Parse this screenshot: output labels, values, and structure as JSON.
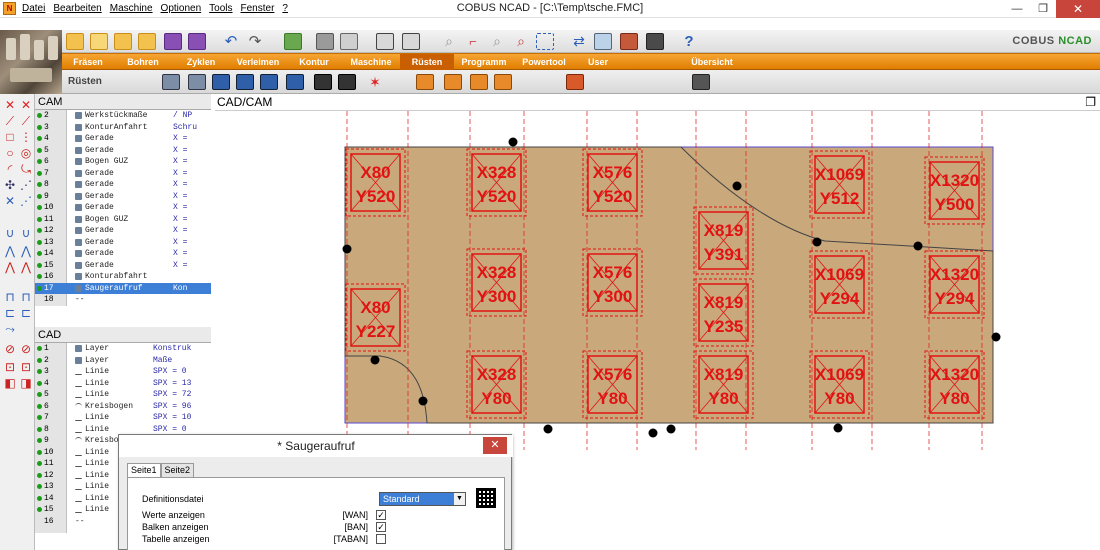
{
  "window": {
    "title": "COBUS NCAD - [C:\\Temp\\tsche.FMC]",
    "app_icon_label": "N",
    "minimize": "—",
    "restore": "❐",
    "close": "✕"
  },
  "menu": [
    {
      "label": "Datei"
    },
    {
      "label": "Bearbeiten"
    },
    {
      "label": "Maschine"
    },
    {
      "label": "Optionen"
    },
    {
      "label": "Tools"
    },
    {
      "label": "Fenster"
    },
    {
      "label": "?"
    }
  ],
  "brand": {
    "part1": "COBUS",
    "part2": "NCAD"
  },
  "tabs": [
    {
      "label": "Fräsen"
    },
    {
      "label": "Bohren"
    },
    {
      "label": "Zyklen"
    },
    {
      "label": "Verleimen"
    },
    {
      "label": "Kontur"
    },
    {
      "label": "Maschine"
    },
    {
      "label": "Rüsten"
    },
    {
      "label": "Programm"
    },
    {
      "label": "Powertool"
    },
    {
      "label": "User"
    },
    {
      "label": "Übersicht"
    }
  ],
  "active_tab": "Rüsten",
  "subbar": {
    "label": "Rüsten"
  },
  "cam": {
    "header": "CAM",
    "rows": [
      {
        "num": "2",
        "icon": "workpiece-icon",
        "name": "Werkstückmaße",
        "val": "/ NP",
        "bullet": true
      },
      {
        "num": "3",
        "icon": "contour-icon",
        "name": "KonturAnfahrt",
        "val": "Schru",
        "bullet": true
      },
      {
        "num": "4",
        "icon": "contour-icon",
        "name": "Gerade",
        "val": "X =",
        "bullet": true
      },
      {
        "num": "5",
        "icon": "contour-icon",
        "name": "Gerade",
        "val": "X =",
        "bullet": true
      },
      {
        "num": "6",
        "icon": "contour-icon",
        "name": "Bogen GUZ",
        "val": "X =",
        "bullet": true
      },
      {
        "num": "7",
        "icon": "contour-icon",
        "name": "Gerade",
        "val": "X =",
        "bullet": true
      },
      {
        "num": "8",
        "icon": "contour-icon",
        "name": "Gerade",
        "val": "X =",
        "bullet": true
      },
      {
        "num": "9",
        "icon": "contour-icon",
        "name": "Gerade",
        "val": "X =",
        "bullet": true
      },
      {
        "num": "10",
        "icon": "contour-icon",
        "name": "Gerade",
        "val": "X =",
        "bullet": true
      },
      {
        "num": "11",
        "icon": "contour-icon",
        "name": "Bogen GUZ",
        "val": "X =",
        "bullet": true
      },
      {
        "num": "12",
        "icon": "contour-icon",
        "name": "Gerade",
        "val": "X =",
        "bullet": true
      },
      {
        "num": "13",
        "icon": "contour-icon",
        "name": "Gerade",
        "val": "X =",
        "bullet": true
      },
      {
        "num": "14",
        "icon": "contour-icon",
        "name": "Gerade",
        "val": "X =",
        "bullet": true
      },
      {
        "num": "15",
        "icon": "contour-icon",
        "name": "Gerade",
        "val": "X =",
        "bullet": true
      },
      {
        "num": "16",
        "icon": "contour-icon",
        "name": "Konturabfahrt",
        "val": "",
        "bullet": true
      },
      {
        "num": "17",
        "icon": "suction-cup-icon",
        "name": "Saugeraufruf",
        "val": "Kon",
        "bullet": true,
        "selected": true
      },
      {
        "num": "18",
        "icon": "",
        "name": "--",
        "val": "",
        "bullet": false
      }
    ]
  },
  "cad": {
    "header": "CAD",
    "rows": [
      {
        "num": "1",
        "icon": "layer-icon",
        "name": "Layer",
        "val": "Konstruk"
      },
      {
        "num": "2",
        "icon": "layer-icon",
        "name": "Layer",
        "val": "Maße"
      },
      {
        "num": "3",
        "icon": "line-icon",
        "name": "Linie",
        "val": "SPX = 0"
      },
      {
        "num": "4",
        "icon": "line-icon",
        "name": "Linie",
        "val": "SPX = 13"
      },
      {
        "num": "5",
        "icon": "line-icon",
        "name": "Linie",
        "val": "SPX = 72"
      },
      {
        "num": "6",
        "icon": "arc-icon",
        "name": "Kreisbogen",
        "val": "SPX = 96"
      },
      {
        "num": "7",
        "icon": "line-icon",
        "name": "Linie",
        "val": "SPX = 10"
      },
      {
        "num": "8",
        "icon": "line-icon",
        "name": "Linie",
        "val": "SPX = 0"
      },
      {
        "num": "9",
        "icon": "arc-icon",
        "name": "Kreisbo",
        "val": ""
      },
      {
        "num": "10",
        "icon": "line-icon",
        "name": "Linie",
        "val": ""
      },
      {
        "num": "11",
        "icon": "line-icon",
        "name": "Linie",
        "val": ""
      },
      {
        "num": "12",
        "icon": "line-icon",
        "name": "Linie",
        "val": ""
      },
      {
        "num": "13",
        "icon": "line-icon",
        "name": "Linie",
        "val": ""
      },
      {
        "num": "14",
        "icon": "line-icon",
        "name": "Linie",
        "val": ""
      },
      {
        "num": "15",
        "icon": "line-icon",
        "name": "Linie",
        "val": ""
      },
      {
        "num": "16",
        "icon": "",
        "name": "--",
        "val": ""
      }
    ]
  },
  "canvas": {
    "header": "CAD/CAM",
    "panel_color": "#c9a97c",
    "cup_color": "#e21212",
    "suction_cups": [
      {
        "x": "X80",
        "y": "Y520"
      },
      {
        "x": "X328",
        "y": "Y520"
      },
      {
        "x": "X576",
        "y": "Y520"
      },
      {
        "x": "X1069",
        "y": "Y512"
      },
      {
        "x": "X1320",
        "y": "Y500"
      },
      {
        "x": "X819",
        "y": "Y391"
      },
      {
        "x": "X328",
        "y": "Y300"
      },
      {
        "x": "X576",
        "y": "Y300"
      },
      {
        "x": "X1069",
        "y": "Y294"
      },
      {
        "x": "X1320",
        "y": "Y294"
      },
      {
        "x": "X80",
        "y": "Y227"
      },
      {
        "x": "X819",
        "y": "Y235"
      },
      {
        "x": "X328",
        "y": "Y80"
      },
      {
        "x": "X576",
        "y": "Y80"
      },
      {
        "x": "X819",
        "y": "Y80"
      },
      {
        "x": "X1069",
        "y": "Y80"
      },
      {
        "x": "X1320",
        "y": "Y80"
      }
    ]
  },
  "dialog": {
    "title": "* Saugeraufruf",
    "close": "✕",
    "tabs": [
      {
        "label": "Seite1"
      },
      {
        "label": "Seite2"
      }
    ],
    "definition_label": "Definitionsdatei",
    "definition_value": "Standard",
    "options": [
      {
        "label": "Werte anzeigen",
        "code": "[WAN]",
        "checked": true
      },
      {
        "label": "Balken anzeigen",
        "code": "[BAN]",
        "checked": true
      },
      {
        "label": "Tabelle anzeigen",
        "code": "[TABAN]",
        "checked": false
      }
    ]
  }
}
